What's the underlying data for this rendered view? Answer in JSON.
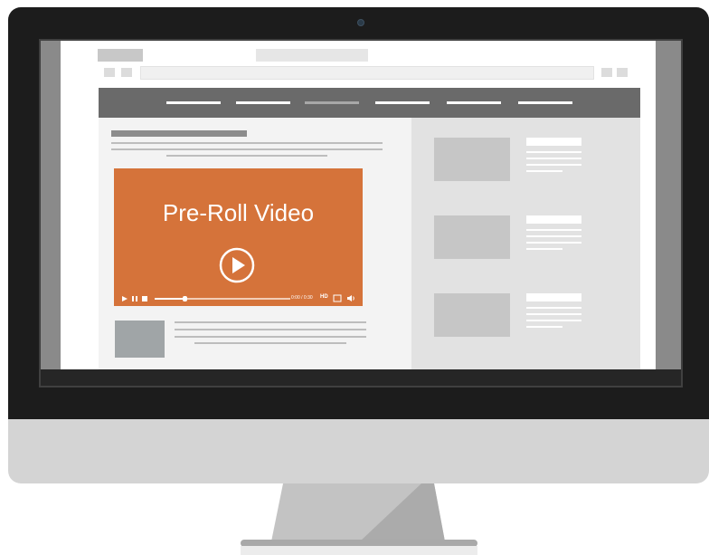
{
  "video": {
    "title": "Pre-Roll Video",
    "accent_color": "#d5733a",
    "progress_fraction": 0.22,
    "time_text": "0:00 / 0:30",
    "hd_label": "HD",
    "icons": [
      "play-icon",
      "pause-icon",
      "stop-icon",
      "hd-icon",
      "fullscreen-icon",
      "volume-icon"
    ]
  },
  "colors": {
    "monitor_bezel": "#1c1c1c",
    "monitor_chin": "#d4d4d4",
    "stand": "#c3c3c3",
    "nav_bar": "#6a6a6a",
    "page_bg": "#f3f3f3",
    "sidebar_bg": "#e2e2e2"
  },
  "nav": {
    "item_count": 6,
    "active_index": 2
  },
  "sidebar": {
    "item_count": 3
  }
}
